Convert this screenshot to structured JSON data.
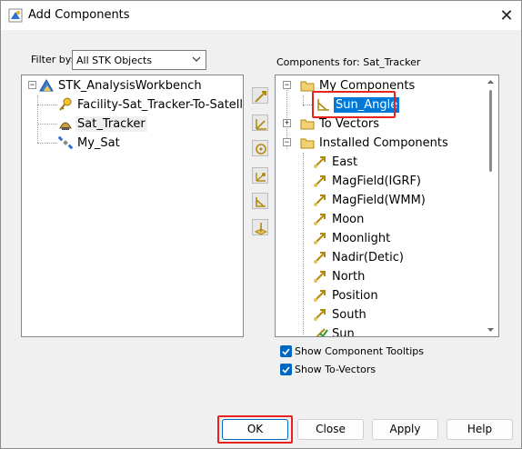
{
  "window": {
    "title": "Add Components",
    "close_glyph": "✕"
  },
  "filter": {
    "label": "Filter by:",
    "value": "All STK Objects"
  },
  "left_tree": {
    "root": "STK_AnalysisWorkbench",
    "children": [
      "Facility-Sat_Tracker-To-Satellit...",
      "Sat_Tracker",
      "My_Sat"
    ]
  },
  "right_tree": {
    "header": "Components for: Sat_Tracker",
    "my_components": "My Components",
    "sun_angle": "Sun_Angle",
    "to_vectors": "To Vectors",
    "installed": "Installed Components",
    "installed_items": [
      "East",
      "MagField(IGRF)",
      "MagField(WMM)",
      "Moon",
      "Moonlight",
      "Nadir(Detic)",
      "North",
      "Position",
      "South",
      "Sun"
    ]
  },
  "options": {
    "show_tooltips": "Show Component Tooltips",
    "show_to_vectors": "Show To-Vectors"
  },
  "buttons": {
    "ok": "OK",
    "close": "Close",
    "apply": "Apply",
    "help": "Help"
  },
  "colors": {
    "selection": "#0078d7",
    "highlight_box": "#e8231f",
    "folder": "#e8c25a",
    "vector_icon": "#c8a020",
    "checkbox": "#0067c0"
  }
}
